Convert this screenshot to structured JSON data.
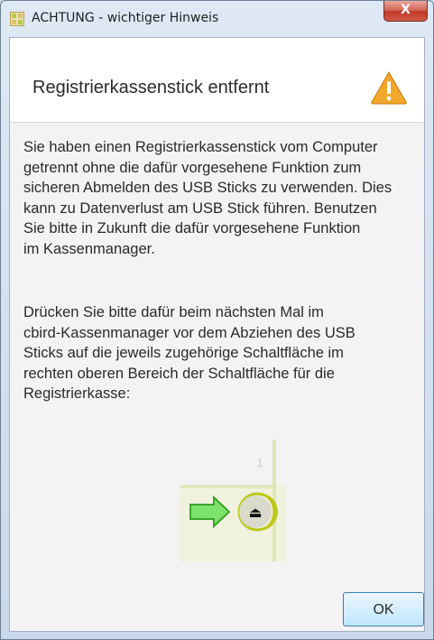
{
  "window": {
    "title": "ACHTUNG - wichtiger Hinweis",
    "close_label": "X"
  },
  "header": {
    "title": "Registrierkassenstick entfernt",
    "icon": "warning-icon"
  },
  "body": {
    "paragraph1_lines": [
      "Sie haben einen Registrierkassenstick vom Computer",
      "getrennt ohne die dafür vorgesehene Funktion zum",
      "sicheren Abmelden des USB Sticks zu verwenden. Dies",
      "kann zu Datenverlust am USB Stick führen. Benutzen",
      "Sie bitte in Zukunft die dafür vorgesehene Funktion",
      "im Kassenmanager."
    ],
    "paragraph2_lines": [
      "Drücken Sie bitte dafür beim nächsten Mal im",
      "cbird-Kassenmanager vor dem Abziehen des USB",
      "Sticks auf die jeweils zugehörige Schaltfläche im",
      "rechten oberen Bereich der Schaltfläche für die",
      "Registrierkasse:"
    ]
  },
  "illustration": {
    "number": "1",
    "eject_symbol": "⏏"
  },
  "buttons": {
    "ok_label": "OK"
  },
  "colors": {
    "arrow_fill": "#7ee36b",
    "warning_fill": "#f2a62a",
    "highlight": "#bcc81a",
    "ok_border": "#3c7fb1"
  }
}
